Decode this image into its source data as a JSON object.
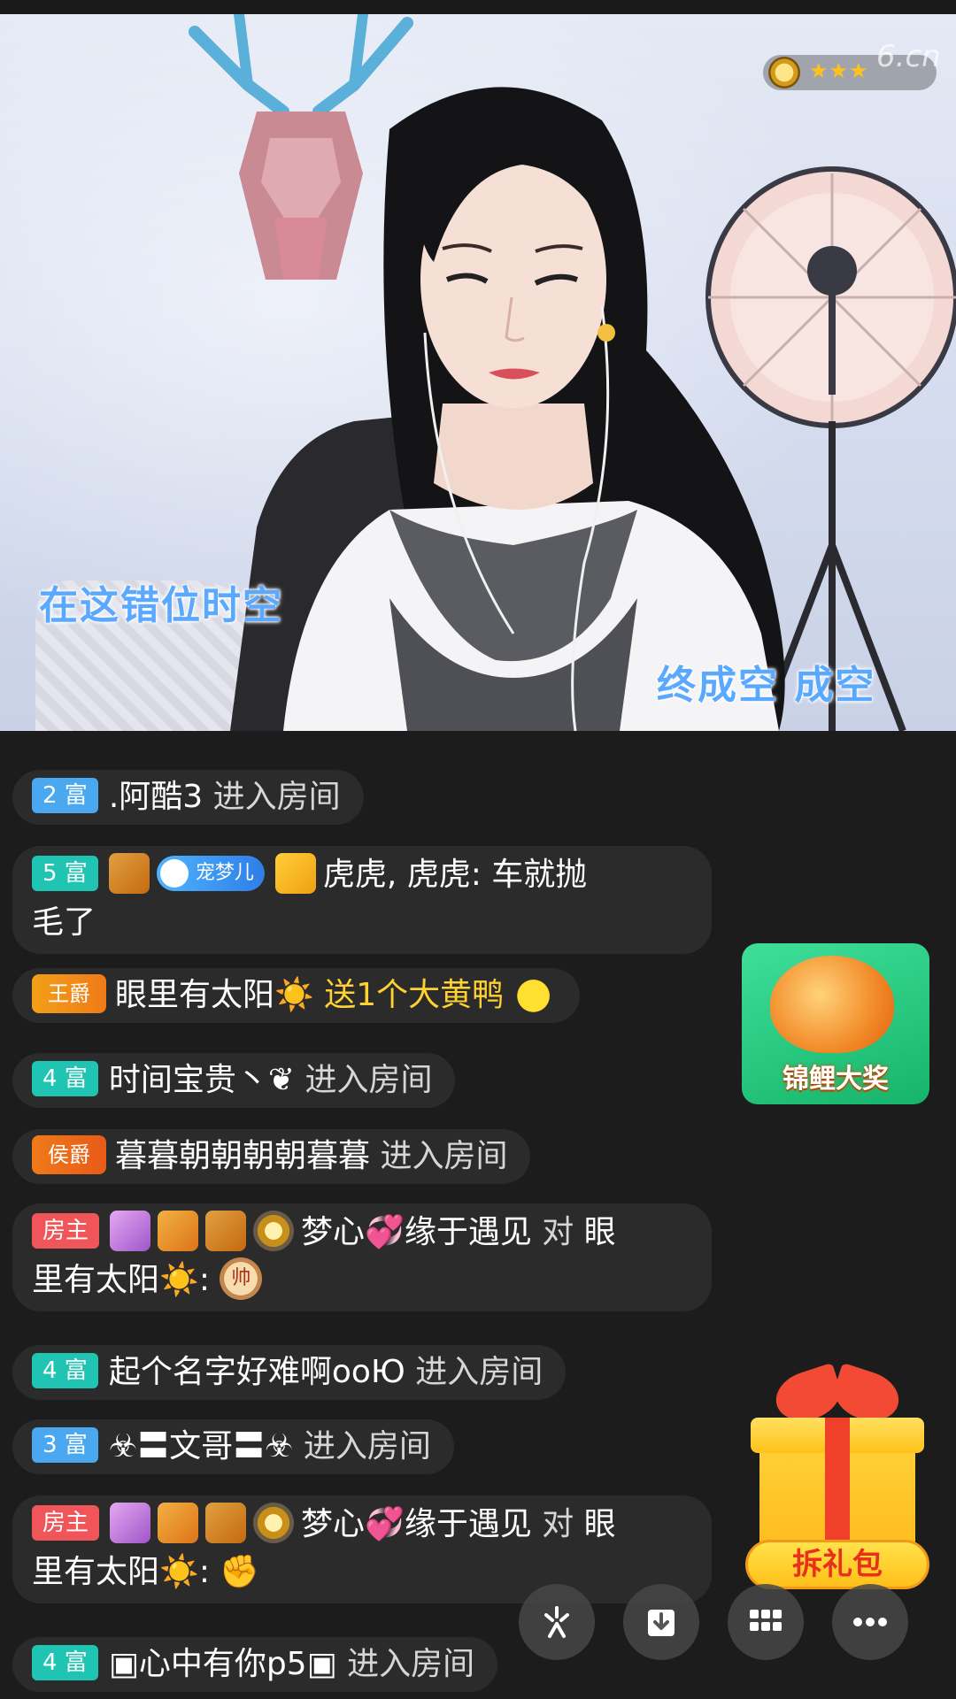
{
  "video": {
    "lyric_left": "在这错位时空",
    "lyric_right": "终成空 成空",
    "rank_stars": "★★★",
    "watermark": "6.cn"
  },
  "chat": {
    "messages": [
      {
        "badge": "2 富",
        "user": ".阿酷3",
        "action": "进入房间"
      },
      {
        "badge": "5 富",
        "fan_badge": "宠梦儿",
        "user": "虎虎,",
        "line1_rest": "虎虎: 车就抛",
        "line2": "毛了"
      },
      {
        "title": "王爵",
        "user": "眼里有太阳☀️",
        "text": "送1个大黄鸭"
      },
      {
        "badge": "4 富",
        "user": "时间宝贵丶❦",
        "action": "进入房间"
      },
      {
        "title": "侯爵",
        "user": "暮暮朝朝朝朝暮暮",
        "action": "进入房间"
      },
      {
        "badge": "房主",
        "user": "梦心💞缘于遇见",
        "mid": "对",
        "target_line1": "眼",
        "line2": "里有太阳☀️:",
        "emoji": "帅"
      },
      {
        "badge": "4 富",
        "user": "起个名字好难啊ooЮ",
        "action": "进入房间"
      },
      {
        "badge": "3 富",
        "user": "☣〓文哥〓☣",
        "action": "进入房间"
      },
      {
        "badge": "房主",
        "user": "梦心💞缘于遇见",
        "mid": "对",
        "target_line1": "眼",
        "line2": "里有太阳☀️:",
        "emoji": "✊"
      },
      {
        "badge": "4 富",
        "user": "▣心中有你p5▣",
        "action": "进入房间"
      }
    ]
  },
  "promo": {
    "koi_label": "锦鲤大奖",
    "gift_label": "拆礼包"
  },
  "colors": {
    "chat_bg": "#1c1c1c",
    "bubble_bg": "#2b2b2b",
    "badge_blue": "#4aa8f0",
    "badge_teal": "#20c4b3",
    "badge_red": "#f0555a",
    "highlight": "#ffd233"
  },
  "icons": [
    "firework-icon",
    "download-icon",
    "grid-icon",
    "more-icon"
  ]
}
